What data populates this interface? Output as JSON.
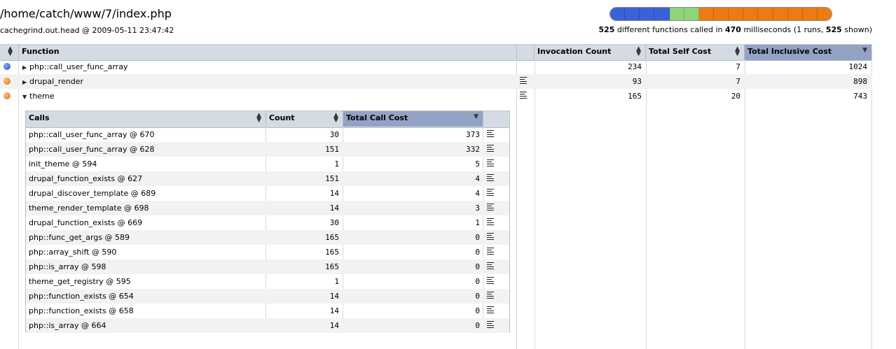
{
  "header": {
    "title": "/home/catch/www/7/index.php",
    "subtitle": "cachegrind.out.head @ 2009-05-11 23:47:42",
    "cost_bar_colors": [
      "#3a62d8",
      "#3a62d8",
      "#3a62d8",
      "#3a62d8",
      "#8fd47a",
      "#8fd47a",
      "#ee7b12",
      "#ee7b12",
      "#ee7b12",
      "#ee7b12",
      "#ee7b12",
      "#ee7b12",
      "#ee7b12",
      "#ee7b12",
      "#ee7b12"
    ],
    "summary": {
      "functions": "525",
      "t1": " different functions called in ",
      "ms": "470",
      "t2": " milliseconds (1 runs, ",
      "shown": "525",
      "t3": " shown)"
    }
  },
  "main_table": {
    "headers": {
      "function": "Function",
      "invocation_count": "Invocation Count",
      "total_self_cost": "Total Self Cost",
      "total_inclusive_cost": "Total Inclusive Cost"
    },
    "rows": [
      {
        "name": "php::call_user_func_array",
        "dot": "blue",
        "expanded": false,
        "has_source": false,
        "invocations": "234",
        "self": "7",
        "inclusive": "1024"
      },
      {
        "name": "drupal_render",
        "dot": "orange",
        "expanded": false,
        "has_source": true,
        "invocations": "93",
        "self": "7",
        "inclusive": "898"
      },
      {
        "name": "theme",
        "dot": "orange",
        "expanded": true,
        "has_source": true,
        "invocations": "165",
        "self": "20",
        "inclusive": "743"
      }
    ]
  },
  "calls_table": {
    "headers": {
      "calls": "Calls",
      "count": "Count",
      "total_call_cost": "Total Call Cost"
    },
    "rows": [
      {
        "call": "php::call_user_func_array @ 670",
        "count": "30",
        "cost": "373"
      },
      {
        "call": "php::call_user_func_array @ 628",
        "count": "151",
        "cost": "332"
      },
      {
        "call": "init_theme @ 594",
        "count": "1",
        "cost": "5"
      },
      {
        "call": "drupal_function_exists @ 627",
        "count": "151",
        "cost": "4"
      },
      {
        "call": "drupal_discover_template @ 689",
        "count": "14",
        "cost": "4"
      },
      {
        "call": "theme_render_template @ 698",
        "count": "14",
        "cost": "3"
      },
      {
        "call": "drupal_function_exists @ 669",
        "count": "30",
        "cost": "1"
      },
      {
        "call": "php::func_get_args @ 589",
        "count": "165",
        "cost": "0"
      },
      {
        "call": "php::array_shift @ 590",
        "count": "165",
        "cost": "0"
      },
      {
        "call": "php::is_array @ 598",
        "count": "165",
        "cost": "0"
      },
      {
        "call": "theme_get_registry @ 595",
        "count": "1",
        "cost": "0"
      },
      {
        "call": "php::function_exists @ 654",
        "count": "14",
        "cost": "0"
      },
      {
        "call": "php::function_exists @ 658",
        "count": "14",
        "cost": "0"
      },
      {
        "call": "php::is_array @ 664",
        "count": "14",
        "cost": "0"
      }
    ]
  }
}
